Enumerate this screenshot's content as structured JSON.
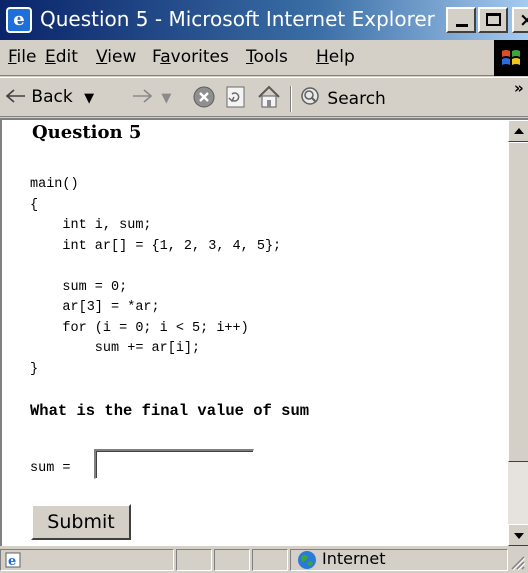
{
  "window": {
    "title": "Question 5 - Microsoft Internet Explorer",
    "controls": {
      "minimize": "_",
      "close": "×"
    }
  },
  "menu": {
    "items": [
      {
        "pre": "",
        "key": "F",
        "post": "ile"
      },
      {
        "pre": "",
        "key": "E",
        "post": "dit"
      },
      {
        "pre": "",
        "key": "V",
        "post": "iew"
      },
      {
        "pre": "F",
        "key": "a",
        "post": "vorites"
      },
      {
        "pre": "",
        "key": "T",
        "post": "ools"
      },
      {
        "pre": "",
        "key": "H",
        "post": "elp"
      }
    ]
  },
  "toolbar": {
    "back_label": "Back",
    "search_label": "Search",
    "chevron": "»"
  },
  "page": {
    "heading": "Question 5",
    "code": "main()\n{\n    int i, sum;\n    int ar[] = {1, 2, 3, 4, 5};\n\n    sum = 0;\n    ar[3] = *ar;\n    for (i = 0; i < 5; i++)\n        sum += ar[i];\n}",
    "question": "What is the final value of sum",
    "sum_label": "sum =",
    "sum_value": "",
    "submit_label": "Submit"
  },
  "status": {
    "zone": "Internet"
  },
  "icons": {
    "app": "ie-icon",
    "back": "back-arrow-icon",
    "forward": "forward-arrow-icon",
    "stop": "stop-icon",
    "refresh": "refresh-icon",
    "home": "home-icon",
    "search": "search-icon",
    "zone": "globe-icon"
  },
  "colors": {
    "titlebar_start": "#0a246a",
    "titlebar_end": "#a6caf0",
    "chrome": "#d4d0c8"
  }
}
